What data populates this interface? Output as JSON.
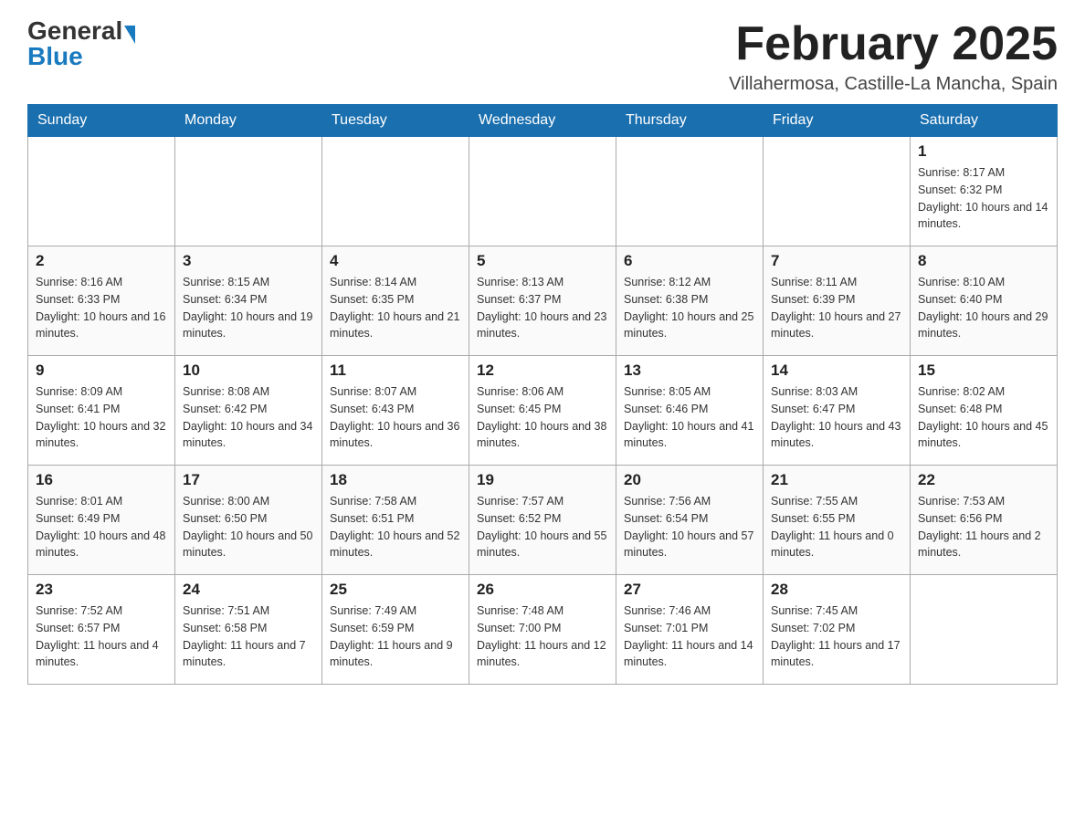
{
  "header": {
    "logo_general": "General",
    "logo_blue": "Blue",
    "month_title": "February 2025",
    "location": "Villahermosa, Castille-La Mancha, Spain"
  },
  "weekdays": [
    "Sunday",
    "Monday",
    "Tuesday",
    "Wednesday",
    "Thursday",
    "Friday",
    "Saturday"
  ],
  "weeks": [
    [
      {
        "day": "",
        "info": ""
      },
      {
        "day": "",
        "info": ""
      },
      {
        "day": "",
        "info": ""
      },
      {
        "day": "",
        "info": ""
      },
      {
        "day": "",
        "info": ""
      },
      {
        "day": "",
        "info": ""
      },
      {
        "day": "1",
        "info": "Sunrise: 8:17 AM\nSunset: 6:32 PM\nDaylight: 10 hours and 14 minutes."
      }
    ],
    [
      {
        "day": "2",
        "info": "Sunrise: 8:16 AM\nSunset: 6:33 PM\nDaylight: 10 hours and 16 minutes."
      },
      {
        "day": "3",
        "info": "Sunrise: 8:15 AM\nSunset: 6:34 PM\nDaylight: 10 hours and 19 minutes."
      },
      {
        "day": "4",
        "info": "Sunrise: 8:14 AM\nSunset: 6:35 PM\nDaylight: 10 hours and 21 minutes."
      },
      {
        "day": "5",
        "info": "Sunrise: 8:13 AM\nSunset: 6:37 PM\nDaylight: 10 hours and 23 minutes."
      },
      {
        "day": "6",
        "info": "Sunrise: 8:12 AM\nSunset: 6:38 PM\nDaylight: 10 hours and 25 minutes."
      },
      {
        "day": "7",
        "info": "Sunrise: 8:11 AM\nSunset: 6:39 PM\nDaylight: 10 hours and 27 minutes."
      },
      {
        "day": "8",
        "info": "Sunrise: 8:10 AM\nSunset: 6:40 PM\nDaylight: 10 hours and 29 minutes."
      }
    ],
    [
      {
        "day": "9",
        "info": "Sunrise: 8:09 AM\nSunset: 6:41 PM\nDaylight: 10 hours and 32 minutes."
      },
      {
        "day": "10",
        "info": "Sunrise: 8:08 AM\nSunset: 6:42 PM\nDaylight: 10 hours and 34 minutes."
      },
      {
        "day": "11",
        "info": "Sunrise: 8:07 AM\nSunset: 6:43 PM\nDaylight: 10 hours and 36 minutes."
      },
      {
        "day": "12",
        "info": "Sunrise: 8:06 AM\nSunset: 6:45 PM\nDaylight: 10 hours and 38 minutes."
      },
      {
        "day": "13",
        "info": "Sunrise: 8:05 AM\nSunset: 6:46 PM\nDaylight: 10 hours and 41 minutes."
      },
      {
        "day": "14",
        "info": "Sunrise: 8:03 AM\nSunset: 6:47 PM\nDaylight: 10 hours and 43 minutes."
      },
      {
        "day": "15",
        "info": "Sunrise: 8:02 AM\nSunset: 6:48 PM\nDaylight: 10 hours and 45 minutes."
      }
    ],
    [
      {
        "day": "16",
        "info": "Sunrise: 8:01 AM\nSunset: 6:49 PM\nDaylight: 10 hours and 48 minutes."
      },
      {
        "day": "17",
        "info": "Sunrise: 8:00 AM\nSunset: 6:50 PM\nDaylight: 10 hours and 50 minutes."
      },
      {
        "day": "18",
        "info": "Sunrise: 7:58 AM\nSunset: 6:51 PM\nDaylight: 10 hours and 52 minutes."
      },
      {
        "day": "19",
        "info": "Sunrise: 7:57 AM\nSunset: 6:52 PM\nDaylight: 10 hours and 55 minutes."
      },
      {
        "day": "20",
        "info": "Sunrise: 7:56 AM\nSunset: 6:54 PM\nDaylight: 10 hours and 57 minutes."
      },
      {
        "day": "21",
        "info": "Sunrise: 7:55 AM\nSunset: 6:55 PM\nDaylight: 11 hours and 0 minutes."
      },
      {
        "day": "22",
        "info": "Sunrise: 7:53 AM\nSunset: 6:56 PM\nDaylight: 11 hours and 2 minutes."
      }
    ],
    [
      {
        "day": "23",
        "info": "Sunrise: 7:52 AM\nSunset: 6:57 PM\nDaylight: 11 hours and 4 minutes."
      },
      {
        "day": "24",
        "info": "Sunrise: 7:51 AM\nSunset: 6:58 PM\nDaylight: 11 hours and 7 minutes."
      },
      {
        "day": "25",
        "info": "Sunrise: 7:49 AM\nSunset: 6:59 PM\nDaylight: 11 hours and 9 minutes."
      },
      {
        "day": "26",
        "info": "Sunrise: 7:48 AM\nSunset: 7:00 PM\nDaylight: 11 hours and 12 minutes."
      },
      {
        "day": "27",
        "info": "Sunrise: 7:46 AM\nSunset: 7:01 PM\nDaylight: 11 hours and 14 minutes."
      },
      {
        "day": "28",
        "info": "Sunrise: 7:45 AM\nSunset: 7:02 PM\nDaylight: 11 hours and 17 minutes."
      },
      {
        "day": "",
        "info": ""
      }
    ]
  ]
}
